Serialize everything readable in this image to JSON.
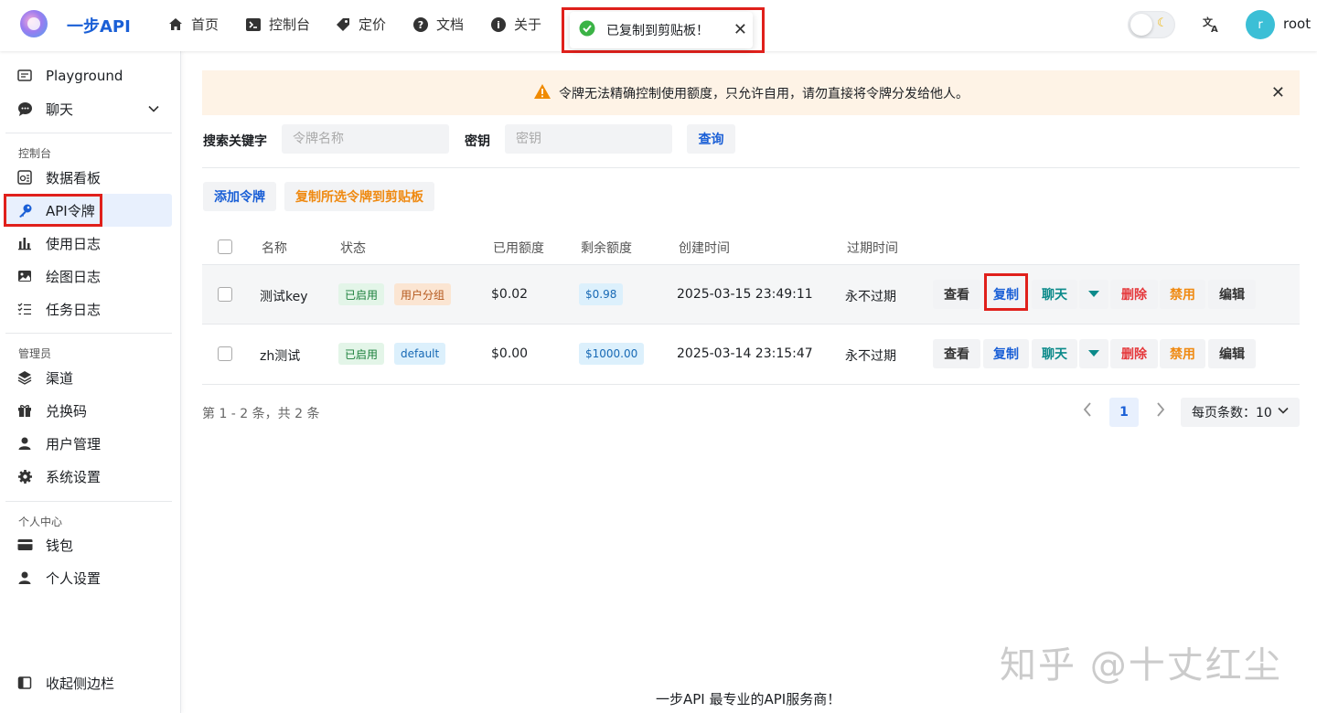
{
  "header": {
    "brand": "一步API",
    "nav": [
      {
        "label": "首页",
        "icon": "home-icon"
      },
      {
        "label": "控制台",
        "icon": "terminal-icon"
      },
      {
        "label": "定价",
        "icon": "tag-icon"
      },
      {
        "label": "文档",
        "icon": "help-icon"
      },
      {
        "label": "关于",
        "icon": "info-icon"
      }
    ],
    "toast": "已复制到剪贴板！",
    "user": {
      "initial": "r",
      "name": "root"
    }
  },
  "sidebar": {
    "items_top": [
      {
        "label": "Playground",
        "icon": "chat-square-icon"
      },
      {
        "label": "聊天",
        "icon": "chat-bubble-icon"
      }
    ],
    "group_console": "控制台",
    "items_console": [
      {
        "label": "数据看板",
        "icon": "dashboard-icon"
      },
      {
        "label": "API令牌",
        "icon": "key-icon"
      },
      {
        "label": "使用日志",
        "icon": "bar-chart-icon"
      },
      {
        "label": "绘图日志",
        "icon": "image-icon"
      },
      {
        "label": "任务日志",
        "icon": "checklist-icon"
      }
    ],
    "group_admin": "管理员",
    "items_admin": [
      {
        "label": "渠道",
        "icon": "layers-icon"
      },
      {
        "label": "兑换码",
        "icon": "gift-icon"
      },
      {
        "label": "用户管理",
        "icon": "user-icon"
      },
      {
        "label": "系统设置",
        "icon": "gear-icon"
      }
    ],
    "group_personal": "个人中心",
    "items_personal": [
      {
        "label": "钱包",
        "icon": "card-icon"
      },
      {
        "label": "个人设置",
        "icon": "person-icon"
      }
    ],
    "collapse": "收起侧边栏"
  },
  "banner": "令牌无法精确控制使用额度，只允许自用，请勿直接将令牌分发给他人。",
  "search": {
    "keyword_label": "搜索关键字",
    "keyword_placeholder": "令牌名称",
    "key_label": "密钥",
    "key_placeholder": "密钥",
    "query_button": "查询"
  },
  "actions": {
    "add": "添加令牌",
    "copy_selected": "复制所选令牌到剪贴板"
  },
  "table": {
    "headers": [
      "名称",
      "状态",
      "已用额度",
      "剩余额度",
      "创建时间",
      "过期时间"
    ],
    "rows": [
      {
        "name": "测试key",
        "status": "已启用",
        "group": "用户分组",
        "used": "$0.02",
        "remaining": "$0.98",
        "created": "2025-03-15 23:49:11",
        "expires": "永不过期"
      },
      {
        "name": "zh测试",
        "status": "已启用",
        "group": "default",
        "used": "$0.00",
        "remaining": "$1000.00",
        "created": "2025-03-14 23:15:47",
        "expires": "永不过期"
      }
    ],
    "row_actions": {
      "view": "查看",
      "copy": "复制",
      "chat": "聊天",
      "delete": "删除",
      "disable": "禁用",
      "edit": "编辑"
    }
  },
  "pagination": {
    "summary": "第 1 - 2 条，共 2 条",
    "current": "1",
    "page_size": "每页条数：10"
  },
  "watermark": "知乎 @十丈红尘",
  "footer": "一步API 最专业的API服务商！"
}
